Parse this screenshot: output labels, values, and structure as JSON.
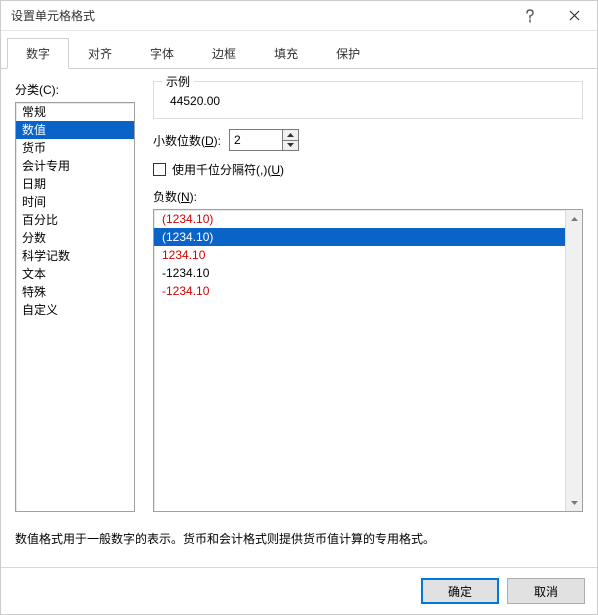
{
  "titlebar": {
    "title": "设置单元格格式",
    "help_icon": "help-icon",
    "close_icon": "close-icon"
  },
  "tabs": [
    {
      "label": "数字",
      "active": true
    },
    {
      "label": "对齐",
      "active": false
    },
    {
      "label": "字体",
      "active": false
    },
    {
      "label": "边框",
      "active": false
    },
    {
      "label": "填充",
      "active": false
    },
    {
      "label": "保护",
      "active": false
    }
  ],
  "category": {
    "label": "分类(C):",
    "items": [
      "常规",
      "数值",
      "货币",
      "会计专用",
      "日期",
      "时间",
      "百分比",
      "分数",
      "科学记数",
      "文本",
      "特殊",
      "自定义"
    ],
    "selected_index": 1
  },
  "sample": {
    "legend": "示例",
    "value": "44520.00"
  },
  "decimals": {
    "label": "小数位数(D):",
    "value": "2"
  },
  "thousands": {
    "checked": false,
    "label": "使用千位分隔符(,)(U)"
  },
  "negatives": {
    "label": "负数(N):",
    "items": [
      {
        "text": "(1234.10)",
        "red": true,
        "selected": false
      },
      {
        "text": "(1234.10)",
        "red": false,
        "selected": true
      },
      {
        "text": "1234.10",
        "red": true,
        "selected": false
      },
      {
        "text": "-1234.10",
        "red": false,
        "selected": false
      },
      {
        "text": "-1234.10",
        "red": true,
        "selected": false
      }
    ]
  },
  "description": "数值格式用于一般数字的表示。货币和会计格式则提供货币值计算的专用格式。",
  "buttons": {
    "ok": "确定",
    "cancel": "取消"
  }
}
